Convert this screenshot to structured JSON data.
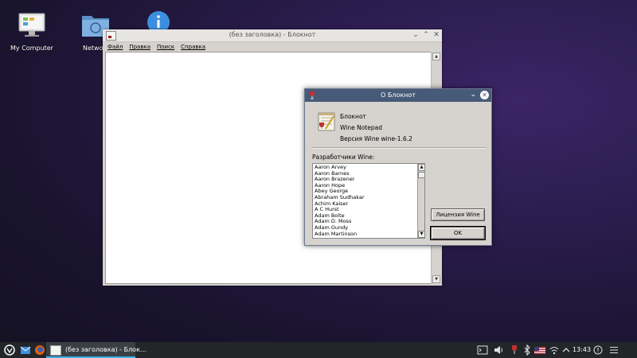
{
  "desktop": {
    "icons": [
      {
        "label": "My Computer"
      },
      {
        "label": "Netwo"
      },
      {
        "label": ""
      }
    ]
  },
  "notepad": {
    "title": "(без заголовка) - Блокнот",
    "menu": [
      "Файл",
      "Правка",
      "Поиск",
      "Справка"
    ]
  },
  "about": {
    "title": "О Блокнот",
    "app_name": "Блокнот",
    "app_desc": "Wine Notepad",
    "version": "Версия Wine wine-1.6.2",
    "developers_label": "Разработчики Wine:",
    "developers": [
      "Aaron Arvey",
      "Aaron Barnes",
      "Aaron Brazener",
      "Aaron Hope",
      "Abey George",
      "Abraham Sudhakar",
      "Achim Kaiser",
      "A C Hurst",
      "Adam Bolte",
      "Adam D. Moss",
      "Adam Gundy",
      "Adam Martinson"
    ],
    "license_button": "Лицензия Wine",
    "ok_button": "OK"
  },
  "taskbar": {
    "task_title": "(без заголовка) - Блок...",
    "clock": "13:43"
  },
  "colors": {
    "dialog_titlebar": "#475a78",
    "taskbar": "#232629",
    "accent": "#3daee9"
  }
}
